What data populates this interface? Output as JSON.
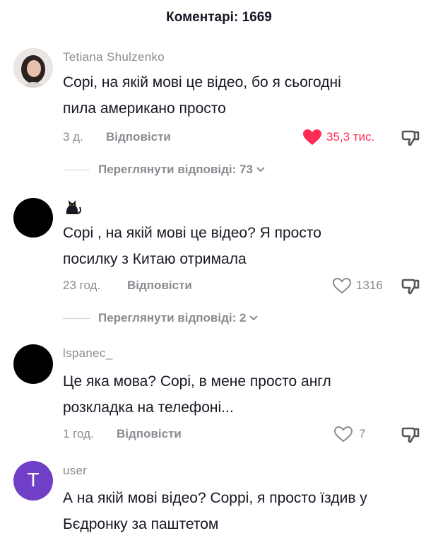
{
  "header": {
    "title": "Коментарі: 1669"
  },
  "comments": [
    {
      "username": "Tetiana Shulzenko",
      "text_line1": "Сорі, на якій мові це відео, бо я сьогодні",
      "text_line2": "пила американо просто",
      "time": "3 д.",
      "reply_label": "Відповісти",
      "likes": "35,3 тис.",
      "liked": true,
      "view_replies": "Переглянути відповіді: 73",
      "avatar_icon": "user-photo"
    },
    {
      "username_icon": "cat-icon",
      "text_line1": "Сорі , на якій мові це відео? Я просто",
      "text_line2": "посилку з Китаю отримала",
      "time": "23 год.",
      "reply_label": "Відповісти",
      "likes": "1316",
      "liked": false,
      "view_replies": "Переглянути відповіді: 2"
    },
    {
      "username": "lspanec_",
      "text_line1": "Це яка мова? Сорі, в мене просто англ",
      "text_line2": "розкладка на телефоні...",
      "time": "1 год.",
      "reply_label": "Відповісти",
      "likes": "7",
      "liked": false
    },
    {
      "username": "user",
      "avatar_letter": "T",
      "text_line1": "А на якій мові відео? Соррі, я просто їздив у",
      "text_line2": "Бєдронку за паштетом"
    }
  ],
  "colors": {
    "accent_red": "#fe2c55",
    "muted": "#8a8b91",
    "avatar_purple": "#6f3fc8"
  }
}
